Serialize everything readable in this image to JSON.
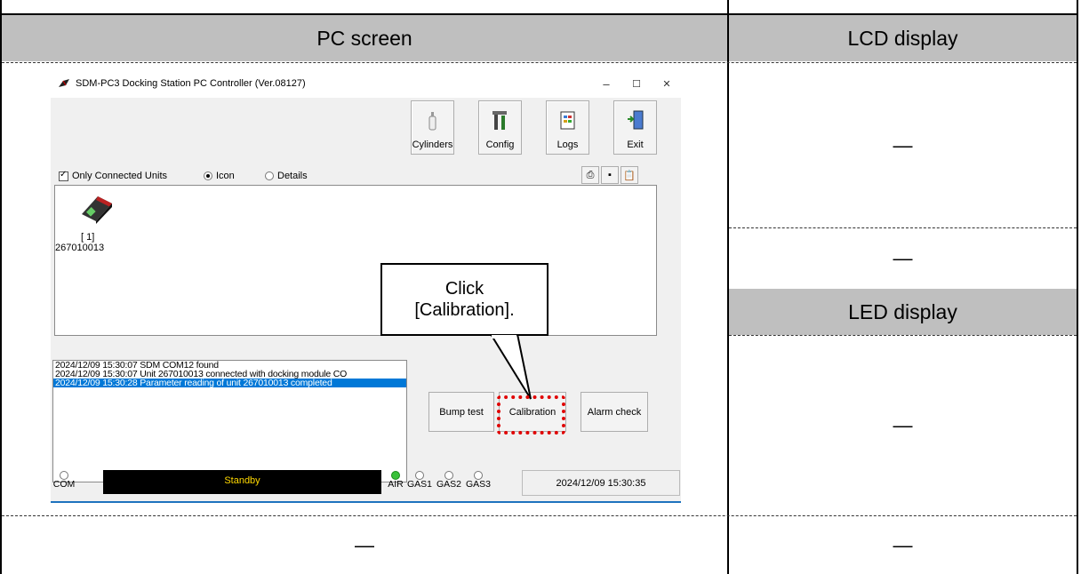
{
  "table": {
    "header_left": "PC screen",
    "header_lcd": "LCD display",
    "header_led": "LED display",
    "cell_lcd_1": "—",
    "cell_lcd_2": "—",
    "cell_led": "—",
    "cell_bottom_left": "—",
    "cell_bottom_right": "—"
  },
  "window": {
    "title": "SDM-PC3 Docking Station PC Controller (Ver.08127)",
    "controls": {
      "minimize": "–",
      "maximize": "☐",
      "close": "✕"
    },
    "toolbar": [
      {
        "label": "Cylinders",
        "icon": "cylinder-icon"
      },
      {
        "label": "Config",
        "icon": "tools-icon"
      },
      {
        "label": "Logs",
        "icon": "logs-icon"
      },
      {
        "label": "Exit",
        "icon": "exit-door-icon"
      }
    ],
    "options": {
      "only_connected": "Only Connected Units",
      "view_icon": "Icon",
      "view_details": "Details"
    },
    "unit": {
      "slot": "[ 1]",
      "serial": "267010013"
    },
    "log": [
      "2024/12/09 15:30:07 SDM COM12 found",
      "2024/12/09 15:30:07 Unit 267010013 connected with docking module CO",
      "2024/12/09 15:30:28 Parameter reading of unit 267010013 completed"
    ],
    "actions": {
      "bump": "Bump test",
      "calibration": "Calibration",
      "alarm": "Alarm check"
    },
    "status": {
      "com": "COM",
      "state": "Standby",
      "air": "AIR",
      "gas1": "GAS1",
      "gas2": "GAS2",
      "gas3": "GAS3",
      "datetime": "2024/12/09 15:30:35"
    }
  },
  "callout": {
    "line1": "Click",
    "line2": "[Calibration]."
  },
  "colors": {
    "header_gray": "#bfbfbf",
    "highlight_red": "#e00000",
    "selection_blue": "#0078d7",
    "status_yellow": "#ffd800"
  }
}
